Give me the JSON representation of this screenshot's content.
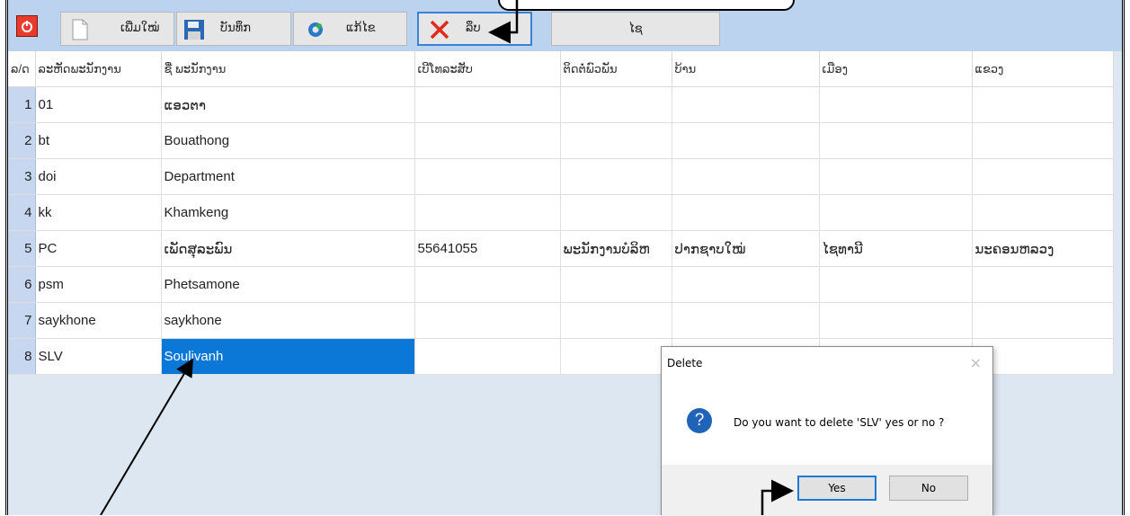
{
  "toolbar": {
    "new_label": "ເພີ່ມໃໝ່",
    "save_label": "ບັນທຶກ",
    "edit_label": "ແກ້ໄຂ",
    "delete_label": "ລຶບ",
    "select_label": "ໄຊ"
  },
  "table": {
    "columns": [
      "ລ/ດ",
      "ລະຫັດພະນັກງານ",
      "ຊື່ ພະນັກງານ",
      "ເບີໂທລະສັບ",
      "ຕິດຕໍ່ພົວພັນ",
      "ບ້ານ",
      "ເມືອງ",
      "ແຂວງ"
    ],
    "rows": [
      {
        "n": "1",
        "code": "01",
        "name": "ແອວຕາ",
        "phone": "",
        "contact": "",
        "village": "",
        "district": "",
        "province": ""
      },
      {
        "n": "2",
        "code": "bt",
        "name": "Bouathong",
        "phone": "",
        "contact": "",
        "village": "",
        "district": "",
        "province": ""
      },
      {
        "n": "3",
        "code": "doi",
        "name": "Department",
        "phone": "",
        "contact": "",
        "village": "",
        "district": "",
        "province": ""
      },
      {
        "n": "4",
        "code": "kk",
        "name": "Khamkeng",
        "phone": "",
        "contact": "",
        "village": "",
        "district": "",
        "province": ""
      },
      {
        "n": "5",
        "code": "PC",
        "name": "ເພັດສຸລະພົນ",
        "phone": "55641055",
        "contact": "ພະນັກງານບໍລິຫ",
        "village": "ປາກຊາບໃໝ່",
        "district": "ໄຊທານີ",
        "province": "ນະຄອນຫລວງ"
      },
      {
        "n": "6",
        "code": "psm",
        "name": "Phetsamone",
        "phone": "",
        "contact": "",
        "village": "",
        "district": "",
        "province": ""
      },
      {
        "n": "7",
        "code": "saykhone",
        "name": "saykhone",
        "phone": "",
        "contact": "",
        "village": "",
        "district": "",
        "province": ""
      },
      {
        "n": "8",
        "code": "SLV",
        "name": "Soulivanh",
        "phone": "",
        "contact": "",
        "village": "",
        "district": "",
        "province": ""
      }
    ]
  },
  "dialog": {
    "title": "Delete",
    "close": "×",
    "icon": "?",
    "message": "Do you want to delete 'SLV' yes or no ?",
    "yes_label": "Yes",
    "no_label": "No"
  },
  "icons": {
    "power": "power-icon",
    "new": "new-document-icon",
    "save": "floppy-disk-icon",
    "edit": "gear-icon",
    "delete": "red-x-icon"
  },
  "colors": {
    "toolbar_bg": "#bcd3f0",
    "selected_cell": "#0b77d7",
    "row_header": "#c6d7ef"
  }
}
